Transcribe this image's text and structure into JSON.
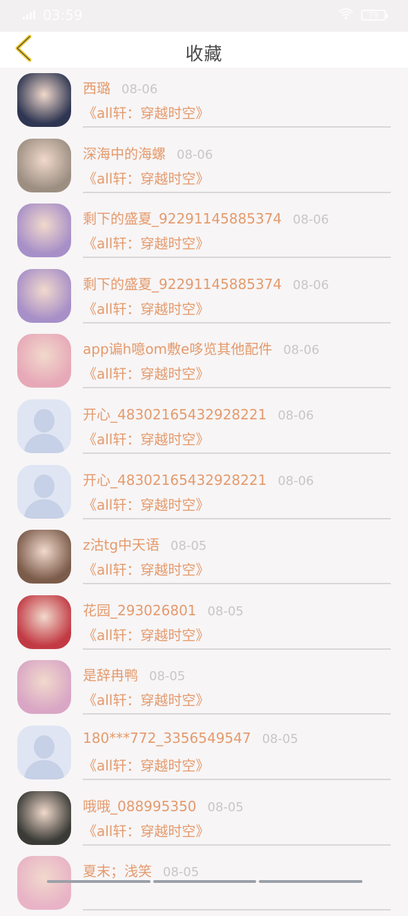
{
  "status_bar": {
    "time": "03:59",
    "carrier_icon": "signal-icon",
    "wifi_icon": "wifi-icon",
    "battery_level": "79"
  },
  "header": {
    "title": "收藏",
    "back_icon": "chevron-left-icon"
  },
  "items": [
    {
      "name": "西璐",
      "date": "08-06",
      "book": "《all轩：穿越时空》",
      "avatar": "photo",
      "avatar_color": "#2f3652"
    },
    {
      "name": "深海中的海螺",
      "date": "08-06",
      "book": "《all轩：穿越时空》",
      "avatar": "photo",
      "avatar_color": "#9c8f82"
    },
    {
      "name": "剩下的盛夏_92291145885374",
      "date": "08-06",
      "book": "《all轩：穿越时空》",
      "avatar": "photo",
      "avatar_color": "#a78fc8"
    },
    {
      "name": "剩下的盛夏_92291145885374",
      "date": "08-06",
      "book": "《all轩：穿越时空》",
      "avatar": "photo",
      "avatar_color": "#a78fc8"
    },
    {
      "name": "app谝h噫om敷e哆览其他配件",
      "date": "08-06",
      "book": "《all轩：穿越时空》",
      "avatar": "photo",
      "avatar_color": "#e7a8b8"
    },
    {
      "name": "开心_48302165432928221",
      "date": "08-06",
      "book": "《all轩：穿越时空》",
      "avatar": "default",
      "avatar_color": "#dfe5f3"
    },
    {
      "name": "开心_48302165432928221",
      "date": "08-06",
      "book": "《all轩：穿越时空》",
      "avatar": "default",
      "avatar_color": "#dfe5f3"
    },
    {
      "name": "z沽tg中天语",
      "date": "08-05",
      "book": "《all轩：穿越时空》",
      "avatar": "photo",
      "avatar_color": "#7b5b4a"
    },
    {
      "name": "花园_293026801",
      "date": "08-05",
      "book": "《all轩：穿越时空》",
      "avatar": "photo",
      "avatar_color": "#c23a44"
    },
    {
      "name": "是辞冉鸭",
      "date": "08-05",
      "book": "《all轩：穿越时空》",
      "avatar": "photo",
      "avatar_color": "#d9a6c5"
    },
    {
      "name": "180***772_3356549547",
      "date": "08-05",
      "book": "《all轩：穿越时空》",
      "avatar": "default",
      "avatar_color": "#dfe5f3"
    },
    {
      "name": "哦哦_088995350",
      "date": "08-05",
      "book": "《all轩：穿越时空》",
      "avatar": "photo",
      "avatar_color": "#3a3b36"
    },
    {
      "name": "夏末；浅笑",
      "date": "08-05",
      "book": "",
      "avatar": "photo",
      "avatar_color": "#e8b3c6"
    }
  ],
  "colors": {
    "accent_text": "#e49a6c",
    "date_text": "#c7c7c7",
    "back_icon": "#e8c52e"
  }
}
